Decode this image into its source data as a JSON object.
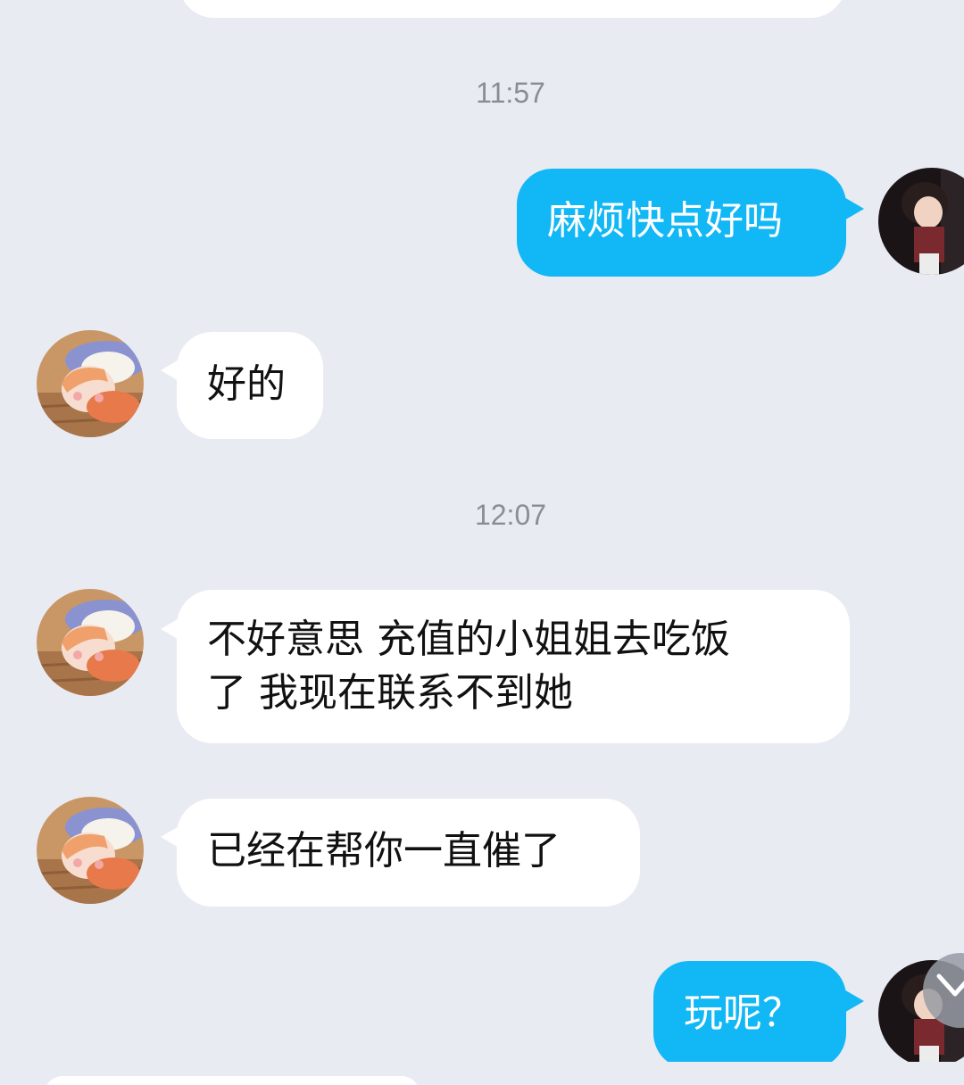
{
  "chat": {
    "messages": [
      {
        "type": "time",
        "text": "11:57"
      },
      {
        "type": "out",
        "text": "麻烦快点好吗",
        "avatar": "user-avatar"
      },
      {
        "type": "in",
        "text": "好的",
        "avatar": "agent-avatar"
      },
      {
        "type": "time",
        "text": "12:07"
      },
      {
        "type": "in",
        "text": "不好意思 充值的小姐姐去吃饭\n了 我现在联系不到她",
        "avatar": "agent-avatar"
      },
      {
        "type": "in",
        "text": "已经在帮你一直催了",
        "avatar": "agent-avatar"
      },
      {
        "type": "out",
        "text": "玩呢？",
        "avatar": "user-avatar"
      }
    ]
  },
  "icons": {
    "scroll_down": "chevron-down-icon"
  },
  "colors": {
    "background": "#e9ebf3",
    "incoming_bubble": "#ffffff",
    "outgoing_bubble": "#12b7f5",
    "timestamp": "#8a8d94"
  }
}
